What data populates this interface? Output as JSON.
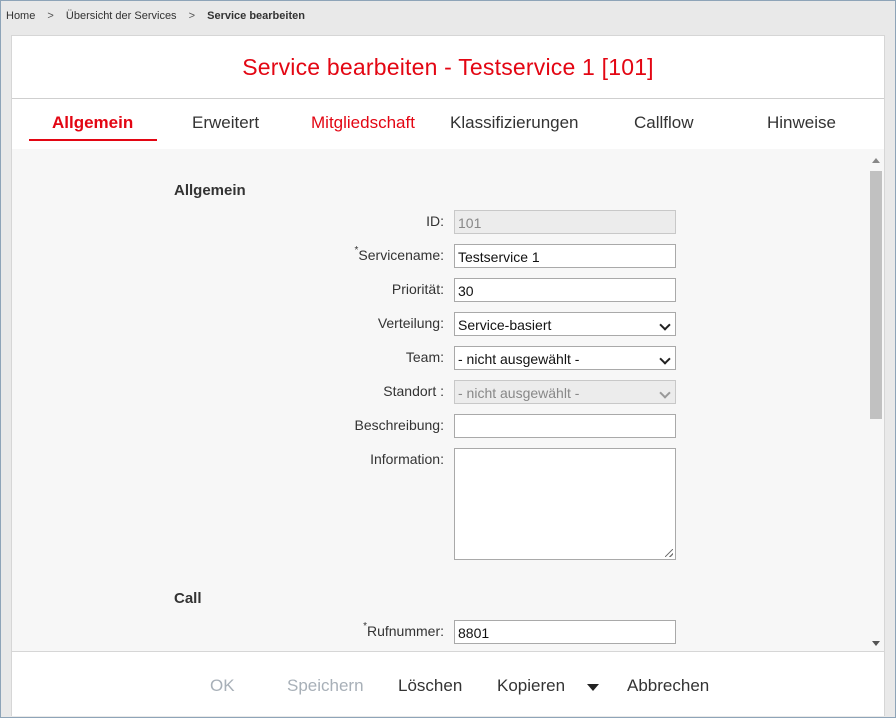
{
  "breadcrumb": {
    "items": [
      "Home",
      "Übersicht der Services",
      "Service bearbeiten"
    ],
    "separator": ">"
  },
  "header": {
    "title": "Service bearbeiten - Testservice 1 [101]"
  },
  "tabs": [
    {
      "label": "Allgemein",
      "active": true
    },
    {
      "label": "Erweitert"
    },
    {
      "label": "Mitgliedschaft"
    },
    {
      "label": "Klassifizierungen"
    },
    {
      "label": "Callflow"
    },
    {
      "label": "Hinweise"
    }
  ],
  "sections": {
    "allgemein": {
      "title": "Allgemein",
      "fields": {
        "id": {
          "label": "ID:",
          "value": "101"
        },
        "servicename": {
          "required_mark": "*",
          "label": "Servicename:",
          "value": "Testservice 1"
        },
        "prioritaet": {
          "label": "Priorität:",
          "value": "30"
        },
        "verteilung": {
          "label": "Verteilung:",
          "value": "Service-basiert"
        },
        "team": {
          "label": "Team:",
          "value": "- nicht ausgewählt -"
        },
        "standort": {
          "label": "Standort :",
          "value": "- nicht ausgewählt -"
        },
        "beschreibung": {
          "label": "Beschreibung:",
          "value": ""
        },
        "information": {
          "label": "Information:",
          "value": ""
        }
      }
    },
    "call": {
      "title": "Call",
      "fields": {
        "rufnummer": {
          "required_mark": "*",
          "label": "Rufnummer:",
          "value": "8801"
        }
      }
    }
  },
  "footer": {
    "ok": "OK",
    "speichern": "Speichern",
    "loeschen": "Löschen",
    "kopieren": "Kopieren",
    "abbrechen": "Abbrechen"
  },
  "colors": {
    "accent": "#e30613"
  }
}
